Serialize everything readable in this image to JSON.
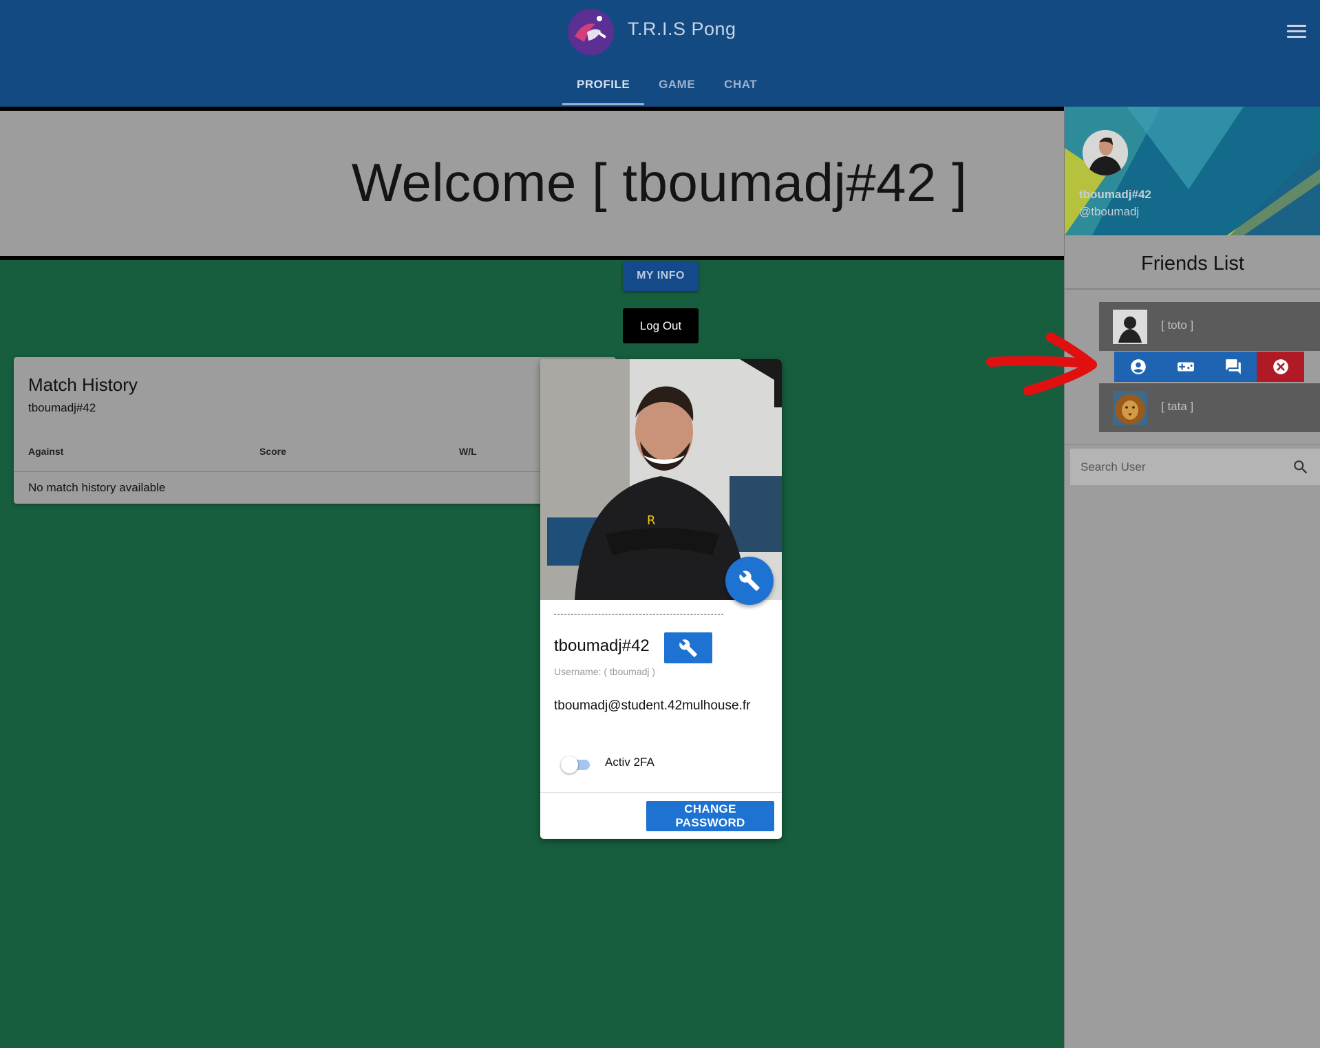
{
  "app": {
    "title": "T.R.I.S Pong",
    "logo_icon": "pong-logo-icon",
    "menu_icon": "hamburger-menu-icon"
  },
  "tabs": [
    {
      "label": "PROFILE",
      "active": true
    },
    {
      "label": "GAME"
    },
    {
      "label": "CHAT"
    }
  ],
  "welcome": {
    "text": "Welcome [ tboumadj#42 ]"
  },
  "buttons": {
    "my_info": "MY INFO",
    "log_out": "Log Out"
  },
  "match_history": {
    "title": "Match History",
    "subtitle": "tboumadj#42",
    "columns": [
      "Against",
      "Score",
      "W/L"
    ],
    "empty_text": "No match history available"
  },
  "profile": {
    "dashes": "------------------------------------------------------",
    "display_name": "tboumadj#42",
    "username_label": "Username: ( tboumadj )",
    "email": "tboumadj@student.42mulhouse.fr",
    "twofa_label": "Activ 2FA",
    "twofa_enabled": false,
    "change_password": "CHANGE PASSWORD"
  },
  "sidebar": {
    "name": "tboumadj#42",
    "handle": "@tboumadj",
    "friends_title": "Friends List",
    "friends": [
      {
        "label": "[ toto ]"
      },
      {
        "label": "[ tata ]"
      }
    ],
    "actions": [
      "account-circle-icon",
      "gamepad-icon",
      "chat-icon",
      "close-circle-icon"
    ],
    "search_placeholder": "Search User"
  },
  "colors": {
    "appbar": "#134a82",
    "main_bg": "#175e3e",
    "primary": "#1e72d1",
    "danger": "#b01a25",
    "annotation": "#e01010"
  }
}
